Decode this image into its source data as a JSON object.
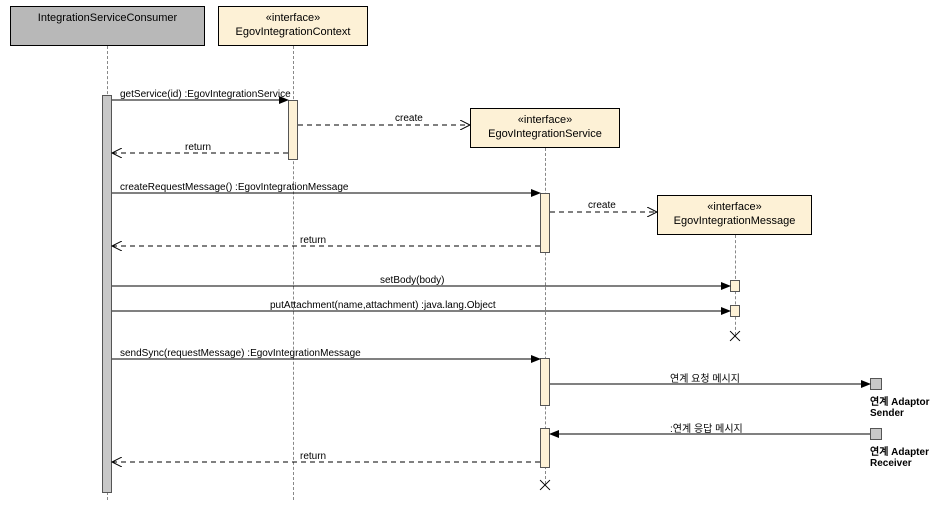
{
  "participants": {
    "consumer": {
      "name": "IntegrationServiceConsumer"
    },
    "context": {
      "stereotype": "«interface»",
      "name": "EgovIntegrationContext"
    },
    "service": {
      "stereotype": "«interface»",
      "name": "EgovIntegrationService"
    },
    "message": {
      "stereotype": "«interface»",
      "name": "EgovIntegrationMessage"
    }
  },
  "messages": {
    "m1": "getService(id) :EgovIntegrationService",
    "m1create": "create",
    "m1return": "return",
    "m2": "createRequestMessage() :EgovIntegrationMessage",
    "m2create": "create",
    "m2return": "return",
    "m3": "setBody(body)",
    "m4": "putAttachment(name,attachment) :java.lang.Object",
    "m5": "sendSync(requestMessage) :EgovIntegrationMessage",
    "m6": "연계 요청 메시지",
    "m7": ":연계 응답 메시지",
    "m5return": "return"
  },
  "externals": {
    "sender": "연계 Adaptor Sender",
    "receiver": "연계 Adapter Receiver"
  },
  "chart_data": {
    "type": "sequence-diagram",
    "participants": [
      {
        "id": "consumer",
        "name": "IntegrationServiceConsumer",
        "stereotype": null
      },
      {
        "id": "context",
        "name": "EgovIntegrationContext",
        "stereotype": "interface"
      },
      {
        "id": "service",
        "name": "EgovIntegrationService",
        "stereotype": "interface"
      },
      {
        "id": "message",
        "name": "EgovIntegrationMessage",
        "stereotype": "interface"
      },
      {
        "id": "sender",
        "name": "연계 Adaptor Sender",
        "stereotype": null,
        "external": true
      },
      {
        "id": "receiver",
        "name": "연계 Adapter Receiver",
        "stereotype": null,
        "external": true
      }
    ],
    "messages": [
      {
        "from": "consumer",
        "to": "context",
        "label": "getService(id) :EgovIntegrationService",
        "kind": "sync"
      },
      {
        "from": "context",
        "to": "service",
        "label": "create",
        "kind": "create"
      },
      {
        "from": "context",
        "to": "consumer",
        "label": "return",
        "kind": "return"
      },
      {
        "from": "consumer",
        "to": "service",
        "label": "createRequestMessage() :EgovIntegrationMessage",
        "kind": "sync"
      },
      {
        "from": "service",
        "to": "message",
        "label": "create",
        "kind": "create"
      },
      {
        "from": "service",
        "to": "consumer",
        "label": "return",
        "kind": "return"
      },
      {
        "from": "consumer",
        "to": "message",
        "label": "setBody(body)",
        "kind": "sync"
      },
      {
        "from": "consumer",
        "to": "message",
        "label": "putAttachment(name,attachment) :java.lang.Object",
        "kind": "sync"
      },
      {
        "from": "consumer",
        "to": "service",
        "label": "sendSync(requestMessage) :EgovIntegrationMessage",
        "kind": "sync"
      },
      {
        "from": "service",
        "to": "sender",
        "label": "연계 요청 메시지",
        "kind": "sync"
      },
      {
        "from": "receiver",
        "to": "service",
        "label": ":연계 응답 메시지",
        "kind": "sync"
      },
      {
        "from": "service",
        "to": "consumer",
        "label": "return",
        "kind": "return"
      }
    ],
    "destroys": [
      "message",
      "service"
    ]
  }
}
